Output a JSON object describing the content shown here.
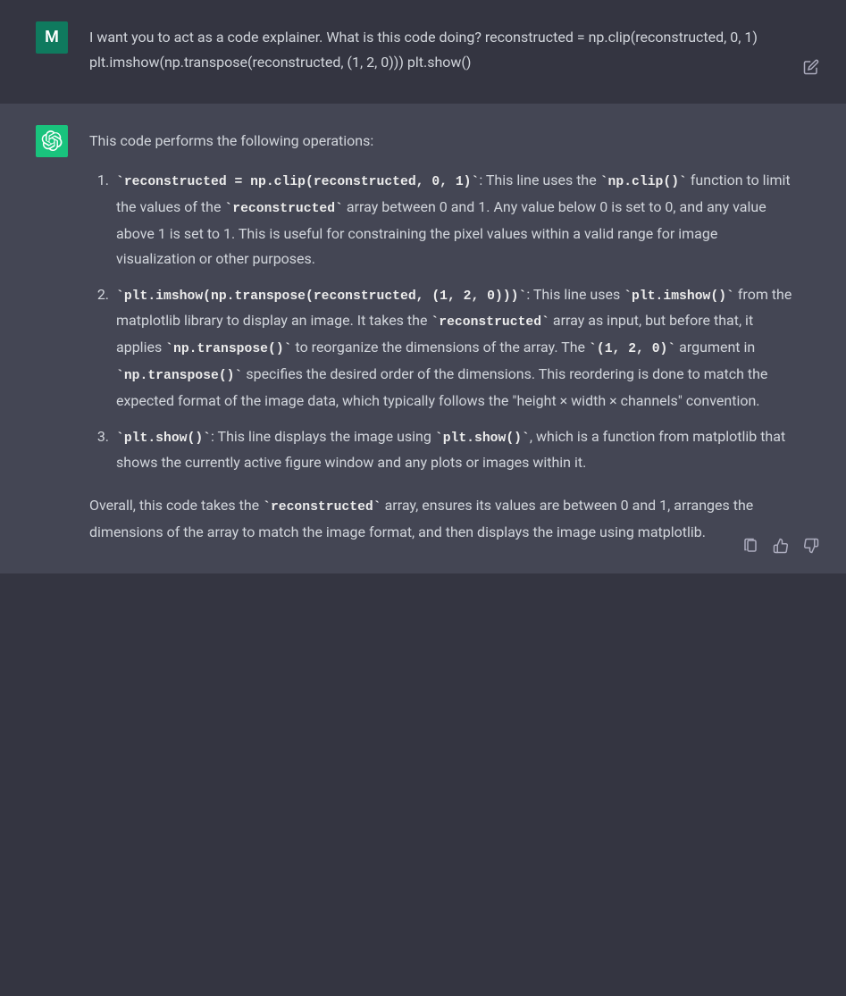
{
  "user": {
    "avatar_letter": "M",
    "message": "I want you to act as a code explainer. What is this code doing? reconstructed = np.clip(reconstructed, 0, 1) plt.imshow(np.transpose(reconstructed, (1, 2, 0))) plt.show()"
  },
  "assistant": {
    "intro": "This code performs the following operations:",
    "items": [
      {
        "code1": "reconstructed = np.clip(reconstructed, 0, 1)",
        "t1": ": This line uses the ",
        "code2": "np.clip()",
        "t2": " function to limit the values of the ",
        "code3": "reconstructed",
        "t3": " array between 0 and 1. Any value below 0 is set to 0, and any value above 1 is set to 1. This is useful for constraining the pixel values within a valid range for image visualization or other purposes."
      },
      {
        "code1": "plt.imshow(np.transpose(reconstructed, (1, 2, 0)))",
        "t1": ": This line uses ",
        "code2": "plt.imshow()",
        "t2": " from the matplotlib library to display an image. It takes the ",
        "code3": "reconstructed",
        "t3": " array as input, but before that, it applies ",
        "code4": "np.transpose()",
        "t4": " to reorganize the dimensions of the array. The ",
        "code5": "(1, 2, 0)",
        "t5": " argument in ",
        "code6": "np.transpose()",
        "t6": " specifies the desired order of the dimensions. This reordering is done to match the expected format of the image data, which typically follows the \"height × width × channels\" convention."
      },
      {
        "code1": "plt.show()",
        "t1": ": This line displays the image using ",
        "code2": "plt.show()",
        "t2": ", which is a function from matplotlib that shows the currently active figure window and any plots or images within it."
      }
    ],
    "summary_pre": "Overall, this code takes the ",
    "summary_code": "reconstructed",
    "summary_post": " array, ensures its values are between 0 and 1, arranges the dimensions of the array to match the image format, and then displays the image using matplotlib."
  }
}
